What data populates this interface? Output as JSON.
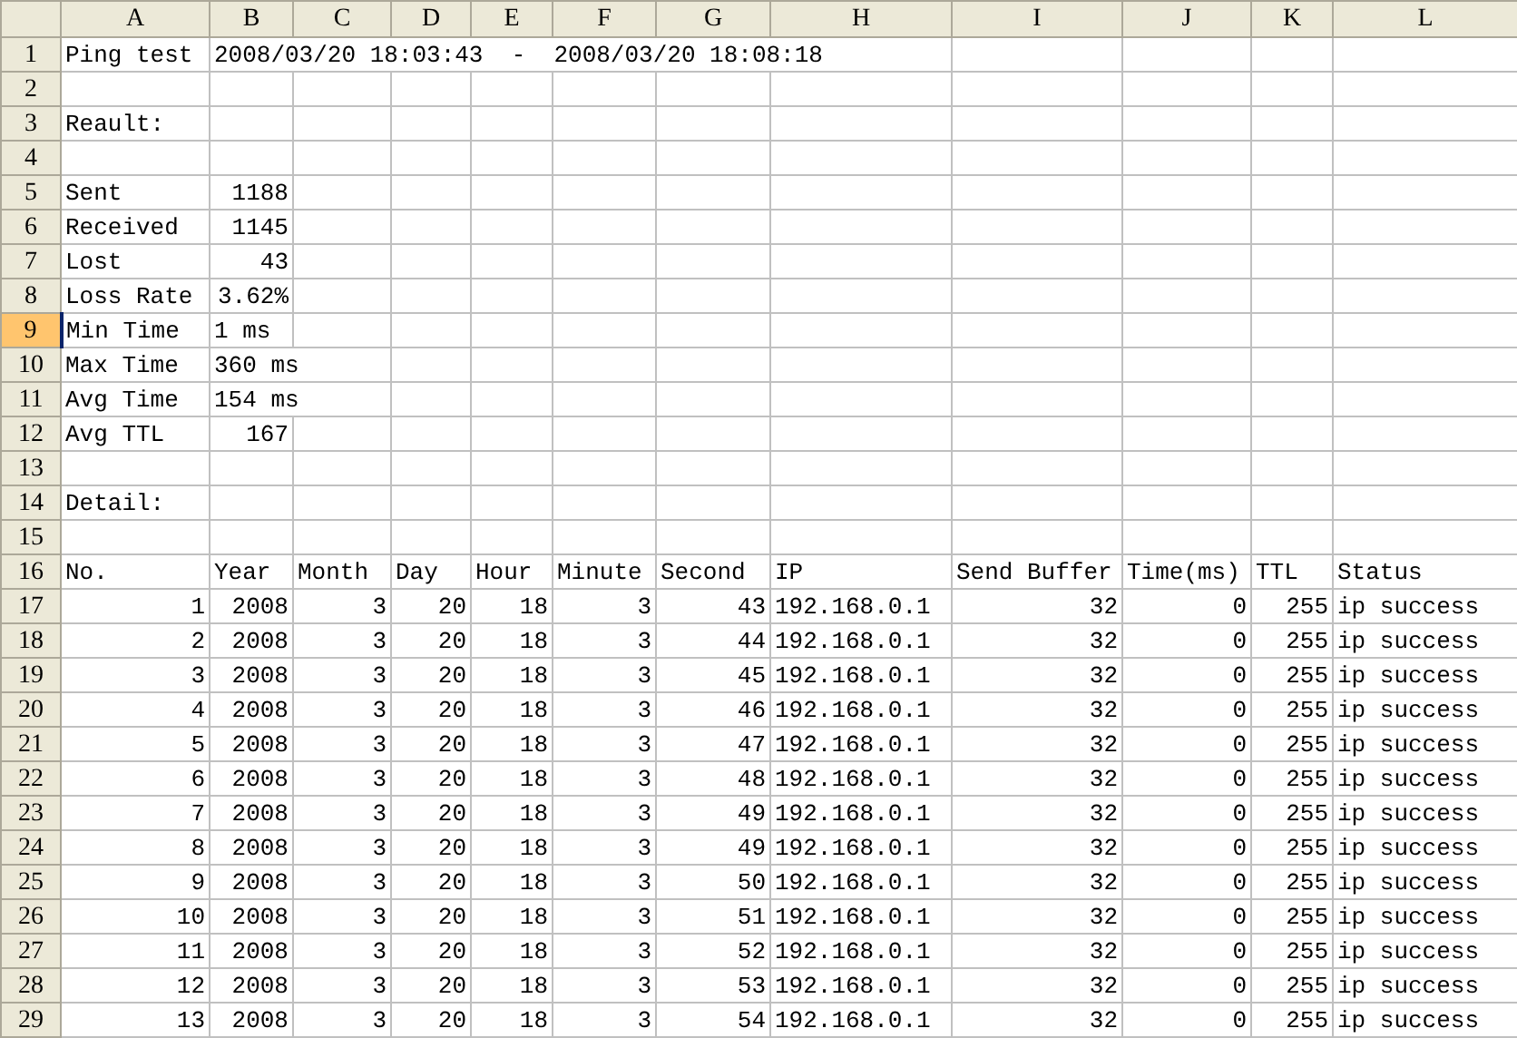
{
  "columns": [
    "A",
    "B",
    "C",
    "D",
    "E",
    "F",
    "G",
    "H",
    "I",
    "J",
    "K",
    "L"
  ],
  "rows": [
    {
      "number": "1",
      "selected": false,
      "cells": [
        {
          "text": "Ping test"
        },
        {
          "text": "2008/03/20 18:03:43  -  2008/03/20 18:08:18"
        }
      ]
    },
    {
      "number": "2",
      "selected": false
    },
    {
      "number": "3",
      "selected": false,
      "cells": [
        {
          "text": "Reault:"
        }
      ]
    },
    {
      "number": "4",
      "selected": false
    },
    {
      "number": "5",
      "selected": false,
      "cells": [
        {
          "text": "Sent"
        },
        {
          "text": "1188",
          "kind": "number"
        }
      ]
    },
    {
      "number": "6",
      "selected": false,
      "cells": [
        {
          "text": "Received"
        },
        {
          "text": "1145",
          "kind": "number"
        }
      ]
    },
    {
      "number": "7",
      "selected": false,
      "cells": [
        {
          "text": "Lost"
        },
        {
          "text": "43",
          "kind": "number"
        }
      ]
    },
    {
      "number": "8",
      "selected": false,
      "cells": [
        {
          "text": "Loss Rate"
        },
        {
          "text": "3.62%",
          "kind": "number"
        }
      ]
    },
    {
      "number": "9",
      "selected": true,
      "cells": [
        {
          "text": "Min Time"
        },
        {
          "text": "1 ms"
        }
      ]
    },
    {
      "number": "10",
      "selected": false,
      "cells": [
        {
          "text": "Max Time"
        },
        {
          "text": "360 ms"
        }
      ]
    },
    {
      "number": "11",
      "selected": false,
      "cells": [
        {
          "text": "Avg Time"
        },
        {
          "text": "154 ms"
        }
      ]
    },
    {
      "number": "12",
      "selected": false,
      "cells": [
        {
          "text": "Avg TTL"
        },
        {
          "text": "167",
          "kind": "number"
        }
      ]
    },
    {
      "number": "13",
      "selected": false
    },
    {
      "number": "14",
      "selected": false,
      "cells": [
        {
          "text": "Detail:"
        }
      ]
    },
    {
      "number": "15",
      "selected": false
    },
    {
      "number": "16",
      "selected": false,
      "cells": [
        {
          "text": "No."
        },
        {
          "text": "Year"
        },
        {
          "text": "Month"
        },
        {
          "text": "Day"
        },
        {
          "text": "Hour"
        },
        {
          "text": "Minute"
        },
        {
          "text": "Second"
        },
        {
          "text": "IP"
        },
        {
          "text": "Send Buffer"
        },
        {
          "text": "Time(ms)"
        },
        {
          "text": "TTL"
        },
        {
          "text": "Status"
        }
      ]
    },
    {
      "number": "17",
      "selected": false,
      "cells": [
        {
          "text": "1",
          "kind": "number"
        },
        {
          "text": "2008",
          "kind": "number"
        },
        {
          "text": "3",
          "kind": "number"
        },
        {
          "text": "20",
          "kind": "number"
        },
        {
          "text": "18",
          "kind": "number"
        },
        {
          "text": "3",
          "kind": "number"
        },
        {
          "text": "43",
          "kind": "number"
        },
        {
          "text": "192.168.0.1"
        },
        {
          "text": "32",
          "kind": "number"
        },
        {
          "text": "0",
          "kind": "number"
        },
        {
          "text": "255",
          "kind": "number"
        },
        {
          "text": "ip success"
        }
      ]
    },
    {
      "number": "18",
      "selected": false,
      "cells": [
        {
          "text": "2",
          "kind": "number"
        },
        {
          "text": "2008",
          "kind": "number"
        },
        {
          "text": "3",
          "kind": "number"
        },
        {
          "text": "20",
          "kind": "number"
        },
        {
          "text": "18",
          "kind": "number"
        },
        {
          "text": "3",
          "kind": "number"
        },
        {
          "text": "44",
          "kind": "number"
        },
        {
          "text": "192.168.0.1"
        },
        {
          "text": "32",
          "kind": "number"
        },
        {
          "text": "0",
          "kind": "number"
        },
        {
          "text": "255",
          "kind": "number"
        },
        {
          "text": "ip success"
        }
      ]
    },
    {
      "number": "19",
      "selected": false,
      "cells": [
        {
          "text": "3",
          "kind": "number"
        },
        {
          "text": "2008",
          "kind": "number"
        },
        {
          "text": "3",
          "kind": "number"
        },
        {
          "text": "20",
          "kind": "number"
        },
        {
          "text": "18",
          "kind": "number"
        },
        {
          "text": "3",
          "kind": "number"
        },
        {
          "text": "45",
          "kind": "number"
        },
        {
          "text": "192.168.0.1"
        },
        {
          "text": "32",
          "kind": "number"
        },
        {
          "text": "0",
          "kind": "number"
        },
        {
          "text": "255",
          "kind": "number"
        },
        {
          "text": "ip success"
        }
      ]
    },
    {
      "number": "20",
      "selected": false,
      "cells": [
        {
          "text": "4",
          "kind": "number"
        },
        {
          "text": "2008",
          "kind": "number"
        },
        {
          "text": "3",
          "kind": "number"
        },
        {
          "text": "20",
          "kind": "number"
        },
        {
          "text": "18",
          "kind": "number"
        },
        {
          "text": "3",
          "kind": "number"
        },
        {
          "text": "46",
          "kind": "number"
        },
        {
          "text": "192.168.0.1"
        },
        {
          "text": "32",
          "kind": "number"
        },
        {
          "text": "0",
          "kind": "number"
        },
        {
          "text": "255",
          "kind": "number"
        },
        {
          "text": "ip success"
        }
      ]
    },
    {
      "number": "21",
      "selected": false,
      "cells": [
        {
          "text": "5",
          "kind": "number"
        },
        {
          "text": "2008",
          "kind": "number"
        },
        {
          "text": "3",
          "kind": "number"
        },
        {
          "text": "20",
          "kind": "number"
        },
        {
          "text": "18",
          "kind": "number"
        },
        {
          "text": "3",
          "kind": "number"
        },
        {
          "text": "47",
          "kind": "number"
        },
        {
          "text": "192.168.0.1"
        },
        {
          "text": "32",
          "kind": "number"
        },
        {
          "text": "0",
          "kind": "number"
        },
        {
          "text": "255",
          "kind": "number"
        },
        {
          "text": "ip success"
        }
      ]
    },
    {
      "number": "22",
      "selected": false,
      "cells": [
        {
          "text": "6",
          "kind": "number"
        },
        {
          "text": "2008",
          "kind": "number"
        },
        {
          "text": "3",
          "kind": "number"
        },
        {
          "text": "20",
          "kind": "number"
        },
        {
          "text": "18",
          "kind": "number"
        },
        {
          "text": "3",
          "kind": "number"
        },
        {
          "text": "48",
          "kind": "number"
        },
        {
          "text": "192.168.0.1"
        },
        {
          "text": "32",
          "kind": "number"
        },
        {
          "text": "0",
          "kind": "number"
        },
        {
          "text": "255",
          "kind": "number"
        },
        {
          "text": "ip success"
        }
      ]
    },
    {
      "number": "23",
      "selected": false,
      "cells": [
        {
          "text": "7",
          "kind": "number"
        },
        {
          "text": "2008",
          "kind": "number"
        },
        {
          "text": "3",
          "kind": "number"
        },
        {
          "text": "20",
          "kind": "number"
        },
        {
          "text": "18",
          "kind": "number"
        },
        {
          "text": "3",
          "kind": "number"
        },
        {
          "text": "49",
          "kind": "number"
        },
        {
          "text": "192.168.0.1"
        },
        {
          "text": "32",
          "kind": "number"
        },
        {
          "text": "0",
          "kind": "number"
        },
        {
          "text": "255",
          "kind": "number"
        },
        {
          "text": "ip success"
        }
      ]
    },
    {
      "number": "24",
      "selected": false,
      "cells": [
        {
          "text": "8",
          "kind": "number"
        },
        {
          "text": "2008",
          "kind": "number"
        },
        {
          "text": "3",
          "kind": "number"
        },
        {
          "text": "20",
          "kind": "number"
        },
        {
          "text": "18",
          "kind": "number"
        },
        {
          "text": "3",
          "kind": "number"
        },
        {
          "text": "49",
          "kind": "number"
        },
        {
          "text": "192.168.0.1"
        },
        {
          "text": "32",
          "kind": "number"
        },
        {
          "text": "0",
          "kind": "number"
        },
        {
          "text": "255",
          "kind": "number"
        },
        {
          "text": "ip success"
        }
      ]
    },
    {
      "number": "25",
      "selected": false,
      "cells": [
        {
          "text": "9",
          "kind": "number"
        },
        {
          "text": "2008",
          "kind": "number"
        },
        {
          "text": "3",
          "kind": "number"
        },
        {
          "text": "20",
          "kind": "number"
        },
        {
          "text": "18",
          "kind": "number"
        },
        {
          "text": "3",
          "kind": "number"
        },
        {
          "text": "50",
          "kind": "number"
        },
        {
          "text": "192.168.0.1"
        },
        {
          "text": "32",
          "kind": "number"
        },
        {
          "text": "0",
          "kind": "number"
        },
        {
          "text": "255",
          "kind": "number"
        },
        {
          "text": "ip success"
        }
      ]
    },
    {
      "number": "26",
      "selected": false,
      "cells": [
        {
          "text": "10",
          "kind": "number"
        },
        {
          "text": "2008",
          "kind": "number"
        },
        {
          "text": "3",
          "kind": "number"
        },
        {
          "text": "20",
          "kind": "number"
        },
        {
          "text": "18",
          "kind": "number"
        },
        {
          "text": "3",
          "kind": "number"
        },
        {
          "text": "51",
          "kind": "number"
        },
        {
          "text": "192.168.0.1"
        },
        {
          "text": "32",
          "kind": "number"
        },
        {
          "text": "0",
          "kind": "number"
        },
        {
          "text": "255",
          "kind": "number"
        },
        {
          "text": "ip success"
        }
      ]
    },
    {
      "number": "27",
      "selected": false,
      "cells": [
        {
          "text": "11",
          "kind": "number"
        },
        {
          "text": "2008",
          "kind": "number"
        },
        {
          "text": "3",
          "kind": "number"
        },
        {
          "text": "20",
          "kind": "number"
        },
        {
          "text": "18",
          "kind": "number"
        },
        {
          "text": "3",
          "kind": "number"
        },
        {
          "text": "52",
          "kind": "number"
        },
        {
          "text": "192.168.0.1"
        },
        {
          "text": "32",
          "kind": "number"
        },
        {
          "text": "0",
          "kind": "number"
        },
        {
          "text": "255",
          "kind": "number"
        },
        {
          "text": "ip success"
        }
      ]
    },
    {
      "number": "28",
      "selected": false,
      "cells": [
        {
          "text": "12",
          "kind": "number"
        },
        {
          "text": "2008",
          "kind": "number"
        },
        {
          "text": "3",
          "kind": "number"
        },
        {
          "text": "20",
          "kind": "number"
        },
        {
          "text": "18",
          "kind": "number"
        },
        {
          "text": "3",
          "kind": "number"
        },
        {
          "text": "53",
          "kind": "number"
        },
        {
          "text": "192.168.0.1"
        },
        {
          "text": "32",
          "kind": "number"
        },
        {
          "text": "0",
          "kind": "number"
        },
        {
          "text": "255",
          "kind": "number"
        },
        {
          "text": "ip success"
        }
      ]
    },
    {
      "number": "29",
      "selected": false,
      "cells": [
        {
          "text": "13",
          "kind": "number"
        },
        {
          "text": "2008",
          "kind": "number"
        },
        {
          "text": "3",
          "kind": "number"
        },
        {
          "text": "20",
          "kind": "number"
        },
        {
          "text": "18",
          "kind": "number"
        },
        {
          "text": "3",
          "kind": "number"
        },
        {
          "text": "54",
          "kind": "number"
        },
        {
          "text": "192.168.0.1"
        },
        {
          "text": "32",
          "kind": "number"
        },
        {
          "text": "0",
          "kind": "number"
        },
        {
          "text": "255",
          "kind": "number"
        },
        {
          "text": "ip success"
        }
      ]
    }
  ]
}
